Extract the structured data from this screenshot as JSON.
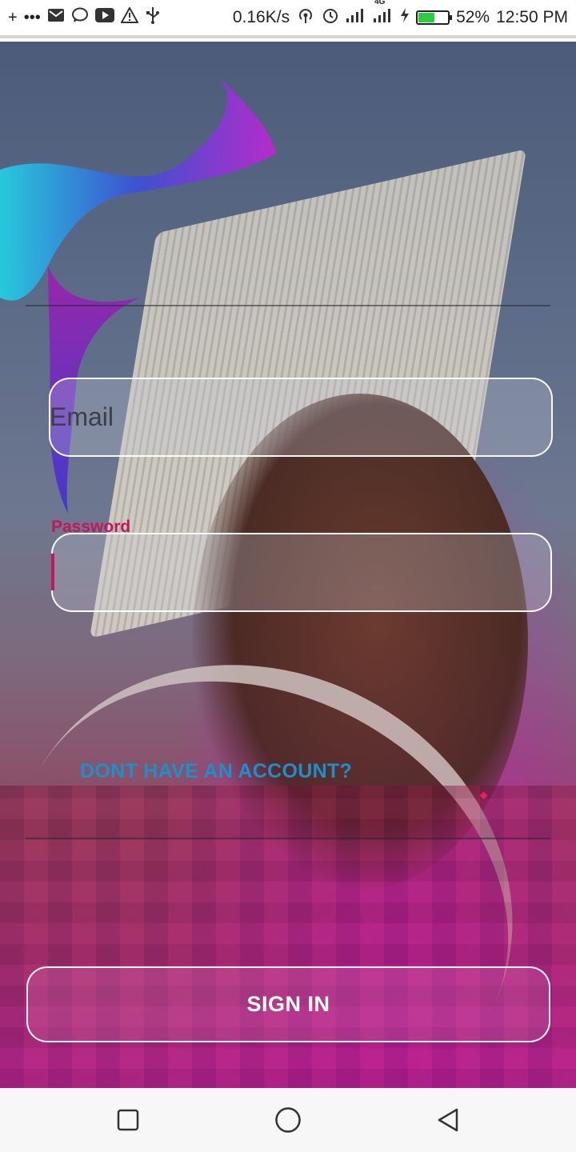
{
  "status_bar": {
    "left_icons": [
      "plus-icon",
      "more-icon",
      "gmail-icon",
      "chat-icon",
      "youtube-icon",
      "warning-icon",
      "usb-icon"
    ],
    "network_speed": "0.16K/s",
    "network_type": "4G",
    "battery_level": 0.52,
    "battery_percent": "52%",
    "time": "12:50 PM"
  },
  "login": {
    "email_placeholder": "Email",
    "password_label": "Password",
    "password_value": "",
    "signup_link": "DONT HAVE AN ACCOUNT?",
    "signin_button": "SIGN IN"
  },
  "colors": {
    "accent": "#c2185b",
    "link": "#1e8fc8"
  },
  "nav_bar": {
    "icons": [
      "recents-square-icon",
      "home-circle-icon",
      "back-triangle-icon"
    ]
  }
}
